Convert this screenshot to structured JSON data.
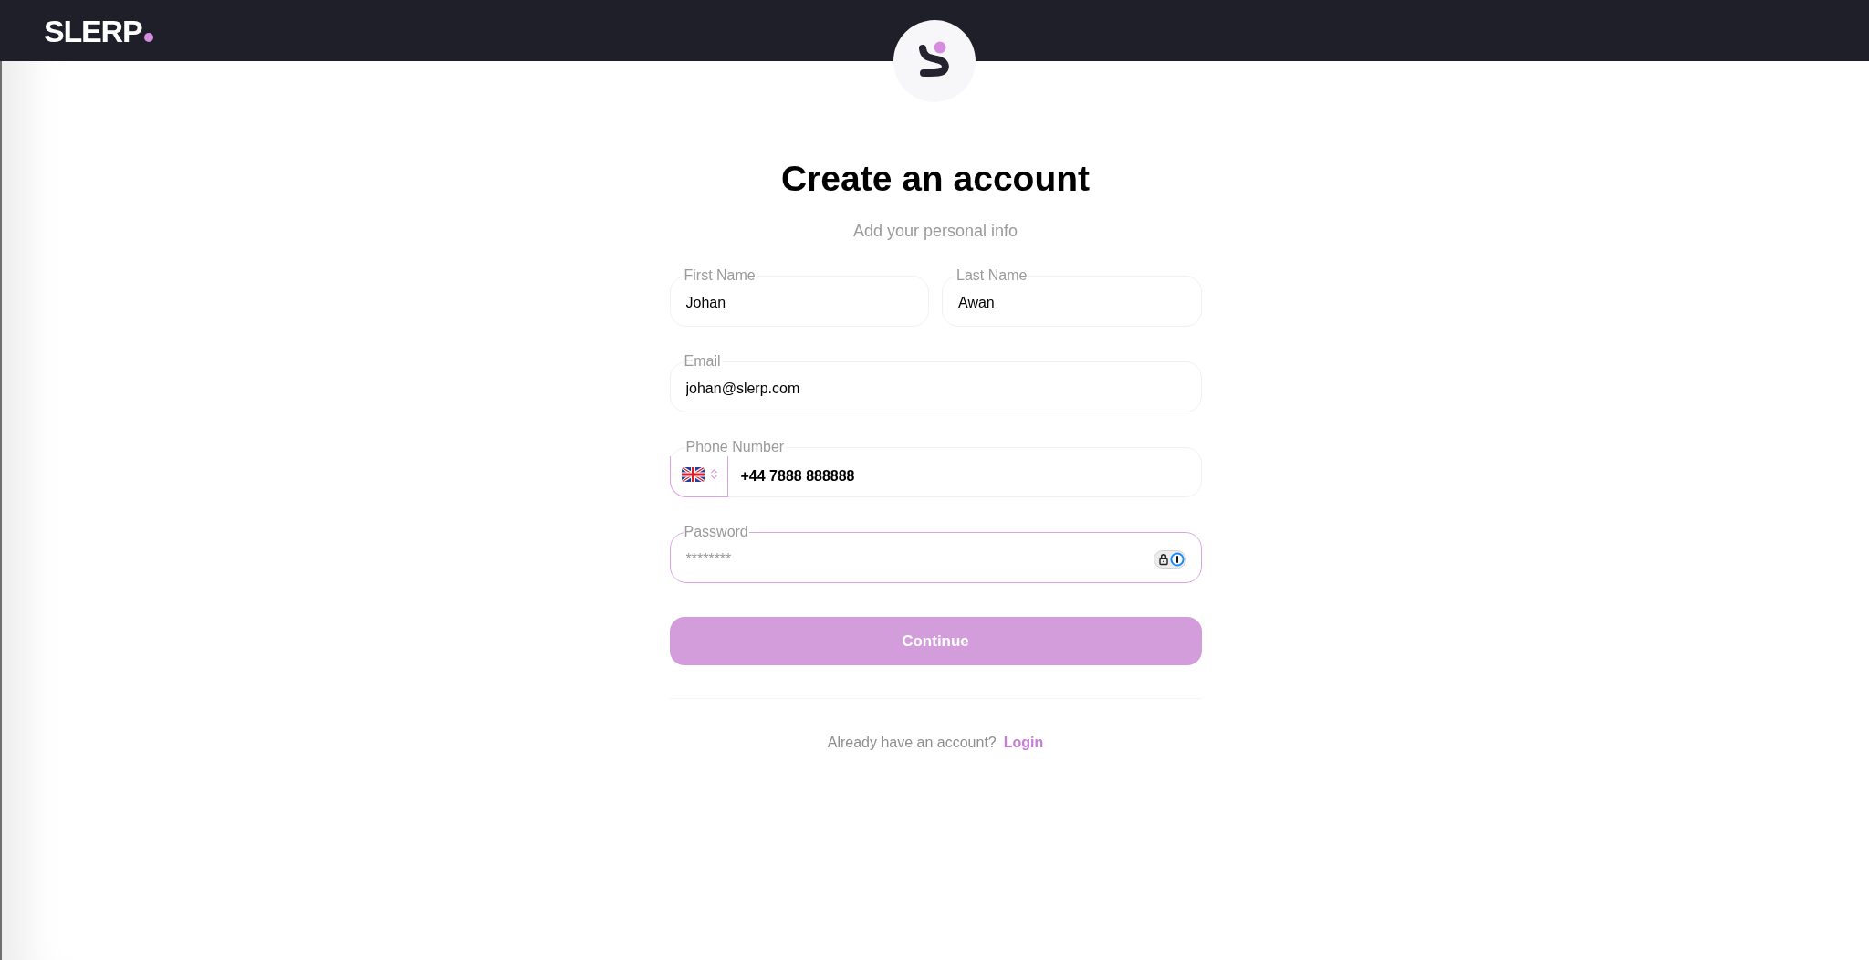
{
  "header": {
    "brand": "SLERP"
  },
  "form": {
    "title": "Create an account",
    "subtitle": "Add your personal info",
    "rows": [
      {
        "fields": [
          {
            "kind": "text",
            "label": "First Name",
            "value": "Johan",
            "focused": false
          },
          {
            "kind": "text",
            "label": "Last Name",
            "value": "Awan",
            "focused": false
          }
        ]
      },
      {
        "fields": [
          {
            "kind": "text",
            "label": "Email",
            "value": "johan@slerp.com",
            "focused": false
          }
        ]
      },
      {
        "fields": [
          {
            "kind": "phone",
            "label": "Phone Number",
            "value": "+44 7888 888888",
            "focused": true
          }
        ]
      },
      {
        "fields": [
          {
            "kind": "password",
            "label": "Password",
            "placeholder": "********",
            "focused": true
          }
        ]
      }
    ],
    "submit": {
      "label": "Continue",
      "disabled": true
    },
    "login_prompt": {
      "text": "Already have an account?",
      "link": "Login"
    }
  }
}
